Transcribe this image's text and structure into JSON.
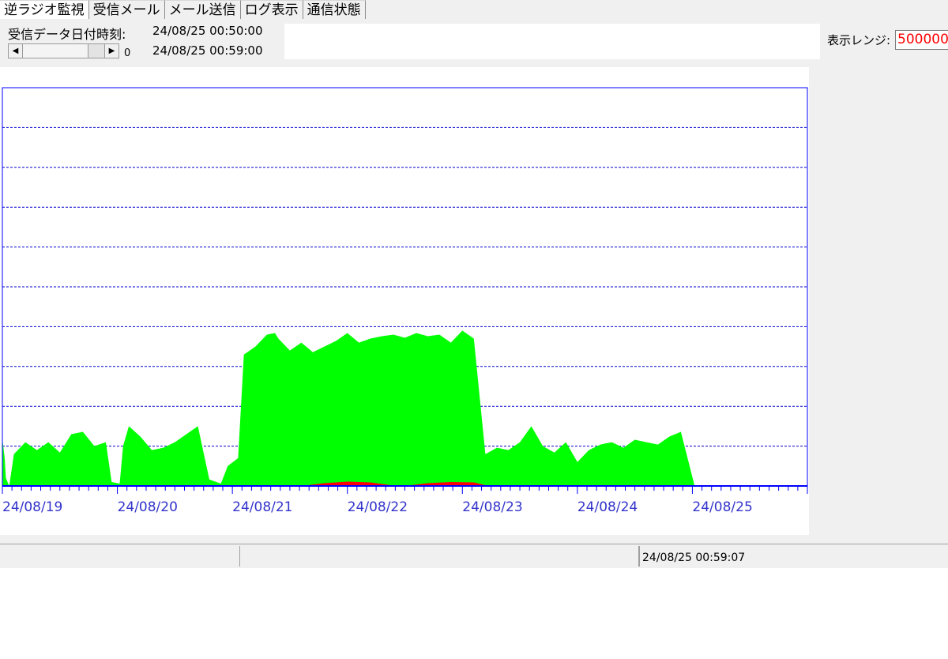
{
  "tabs": [
    {
      "label": "逆ラジオ監視",
      "active": true
    },
    {
      "label": "受信メール",
      "active": false
    },
    {
      "label": "メール送信",
      "active": false
    },
    {
      "label": "ログ表示",
      "active": false
    },
    {
      "label": "通信状態",
      "active": false
    }
  ],
  "receive": {
    "label": "受信データ日付時刻:",
    "start_time": "24/08/25 00:50:00",
    "end_time": "24/08/25 00:59:00",
    "scroll_value": "0"
  },
  "range": {
    "label": "表示レンジ:",
    "value": "500000"
  },
  "statusbar": {
    "timestamp": "24/08/25 00:59:07"
  },
  "colors": {
    "series_primary": "#00ff00",
    "series_secondary": "#ff0000",
    "axis": "#0000ff",
    "gridline": "#0000cc",
    "axis_label": "#3333cc"
  },
  "chart_data": {
    "type": "area",
    "categories": [
      "24/08/19",
      "24/08/20",
      "24/08/21",
      "24/08/22",
      "24/08/23",
      "24/08/24",
      "24/08/25"
    ],
    "x_range": [
      0,
      7
    ],
    "y_range": [
      0,
      500000
    ],
    "grid": true,
    "grid_lines": 10,
    "series": [
      {
        "color": "#00ff00",
        "x": [
          0,
          0.02,
          0.03,
          0.06,
          0.1,
          0.2,
          0.3,
          0.4,
          0.5,
          0.6,
          0.7,
          0.8,
          0.9,
          0.95,
          1.02,
          1.05,
          1.1,
          1.2,
          1.3,
          1.4,
          1.5,
          1.6,
          1.7,
          1.8,
          1.9,
          1.96,
          2.05,
          2.1,
          2.2,
          2.3,
          2.37,
          2.4,
          2.5,
          2.6,
          2.7,
          2.8,
          2.9,
          3.0,
          3.1,
          3.2,
          3.3,
          3.4,
          3.5,
          3.6,
          3.7,
          3.8,
          3.9,
          4.0,
          4.1,
          4.2,
          4.3,
          4.4,
          4.5,
          4.6,
          4.7,
          4.8,
          4.9,
          5.0,
          5.1,
          5.2,
          5.3,
          5.4,
          5.5,
          5.6,
          5.7,
          5.8,
          5.9,
          6.02,
          6.04
        ],
        "y": [
          60000,
          35000,
          10000,
          0,
          40000,
          55000,
          45000,
          55000,
          42000,
          65000,
          68000,
          50000,
          55000,
          5000,
          3000,
          50000,
          75000,
          62000,
          45000,
          48000,
          55000,
          65000,
          75000,
          8000,
          3000,
          25000,
          35000,
          165000,
          175000,
          190000,
          192000,
          185000,
          170000,
          180000,
          168000,
          175000,
          182000,
          192000,
          180000,
          185000,
          188000,
          190000,
          186000,
          192000,
          188000,
          190000,
          180000,
          195000,
          185000,
          40000,
          48000,
          45000,
          55000,
          75000,
          50000,
          42000,
          55000,
          30000,
          45000,
          52000,
          55000,
          48000,
          58000,
          55000,
          52000,
          62000,
          68000,
          0,
          0
        ]
      },
      {
        "color": "#ff0000",
        "x": [
          2.6,
          2.8,
          3.0,
          3.2,
          3.4,
          3.5,
          3.7,
          3.9,
          4.1,
          4.2,
          4.3
        ],
        "y": [
          0,
          3500,
          5500,
          4500,
          500,
          0,
          3500,
          5000,
          4500,
          1000,
          0
        ]
      }
    ]
  }
}
